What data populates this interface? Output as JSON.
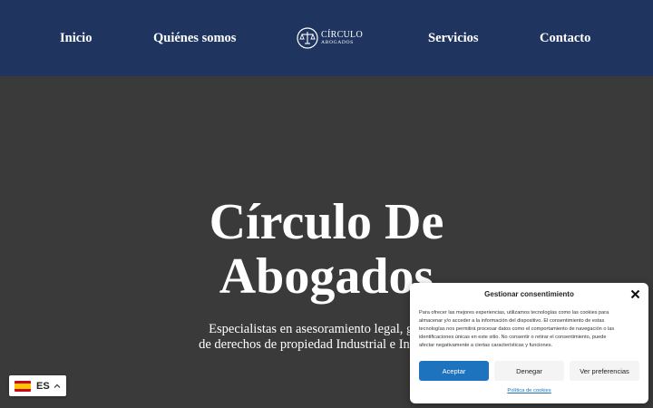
{
  "nav": {
    "items": [
      {
        "label": "Inicio"
      },
      {
        "label": "Quiénes somos"
      },
      {
        "label": "Servicios"
      },
      {
        "label": "Contacto"
      }
    ],
    "logo": {
      "line1": "CÍRCULO",
      "line2": "ABOGADOS",
      "icon": "scales-icon"
    }
  },
  "hero": {
    "title_line1": "Círculo De",
    "title_line2": "Abogados",
    "subtitle_line1": "Especialistas en asesoramiento legal, gestión",
    "subtitle_line2": "de derechos de propiedad Industrial e Intelectual"
  },
  "language": {
    "code": "ES",
    "flag": "spain-flag-icon"
  },
  "cookie": {
    "title": "Gestionar consentimiento",
    "lines": [
      "Para ofrecer las mejores experiencias, utilizamos tecnologías como las cookies para",
      "almacenar y/o acceder a la información del dispositivo. El consentimiento de estas",
      "tecnologías nos permitirá procesar datos como el comportamiento de navegación o las",
      "identificaciones únicas en este sitio. No consentir o retirar el consentimiento, puede",
      "afectar negativamente a ciertas características y funciones."
    ],
    "accept": "Aceptar",
    "deny": "Denegar",
    "preferences": "Ver preferencias",
    "policy": "Política de cookies"
  },
  "colors": {
    "header_bg": "#1f3560",
    "hero_bg": "#3a3a3a",
    "accept_bg": "#1e73be"
  }
}
